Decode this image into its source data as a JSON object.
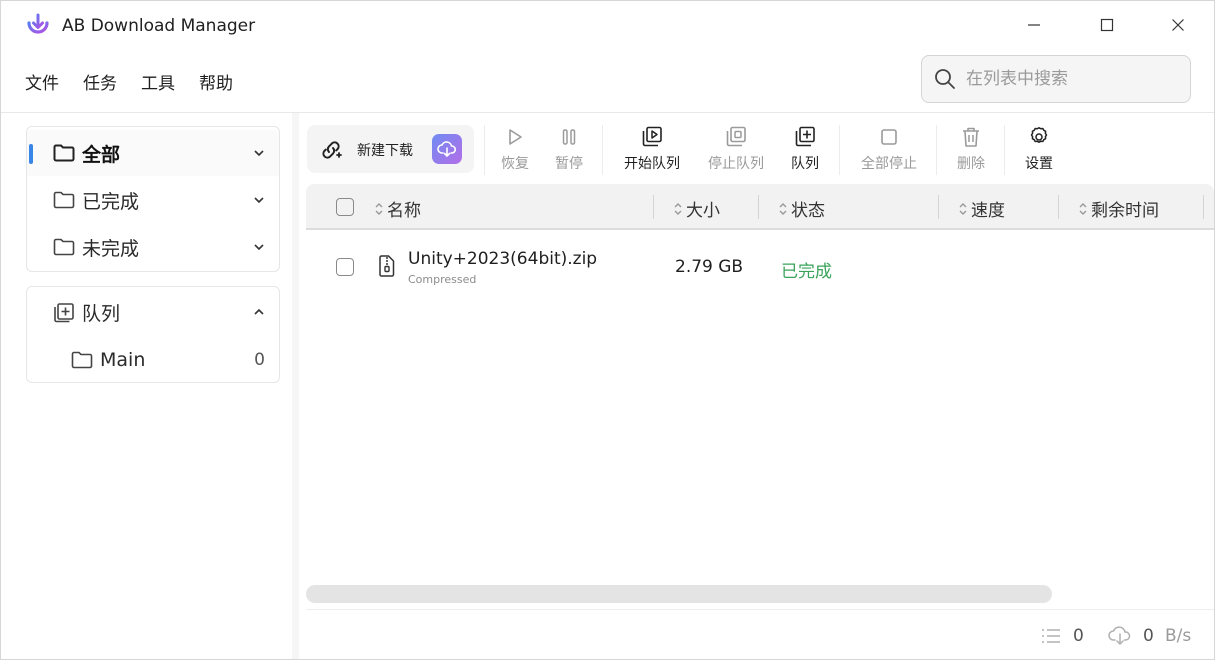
{
  "window": {
    "title": "AB Download Manager"
  },
  "menu": [
    "文件",
    "任务",
    "工具",
    "帮助"
  ],
  "search": {
    "placeholder": "在列表中搜索",
    "value": ""
  },
  "sidebar": {
    "status_items": [
      {
        "label": "全部",
        "active": true
      },
      {
        "label": "已完成",
        "active": false
      },
      {
        "label": "未完成",
        "active": false
      }
    ],
    "queue": {
      "label": "队列",
      "items": [
        {
          "label": "Main",
          "count": "0"
        }
      ]
    }
  },
  "toolbar": {
    "new_download": "新建下载",
    "resume": "恢复",
    "pause": "暂停",
    "start_queue": "开始队列",
    "stop_queue": "停止队列",
    "queue": "队列",
    "stop_all": "全部停止",
    "delete": "删除",
    "settings": "设置"
  },
  "table": {
    "columns": [
      "名称",
      "大小",
      "状态",
      "速度",
      "剩余时间"
    ],
    "rows": [
      {
        "name": "Unity+2023(64bit).zip",
        "type": "Compressed",
        "size": "2.79 GB",
        "status": "已完成",
        "speed": "",
        "remaining": ""
      }
    ]
  },
  "footer": {
    "active_count": "0",
    "speed_value": "0",
    "speed_unit": "B/s"
  },
  "colors": {
    "accent": "#3a86e8",
    "status_done": "#3aa35b",
    "brand_gradient_start": "#6f8bf2",
    "brand_gradient_end": "#b46ee8"
  }
}
